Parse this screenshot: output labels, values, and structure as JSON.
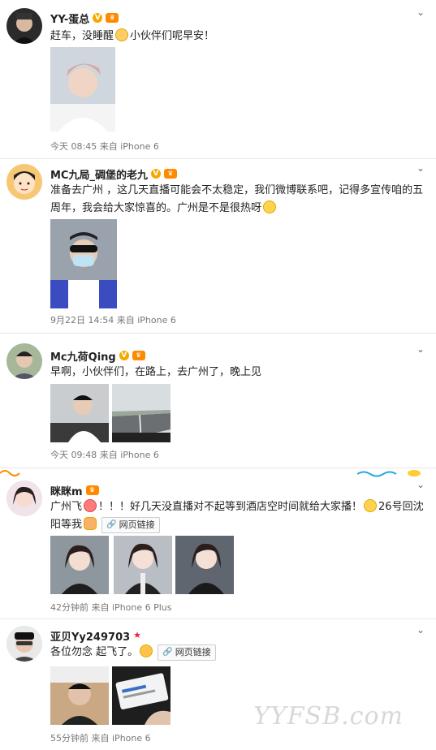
{
  "posts": [
    {
      "name": "YY-蛋总",
      "text_before": "赶车，没睡醒",
      "text_after": "小伙伴们呢早安！",
      "time": "今天 08:45",
      "source_prefix": "来自",
      "source": "iPhone 6"
    },
    {
      "name": "MC九局_碉堡的老九",
      "text": "准备去广州 ，这几天直播可能会不太稳定，我们微博联系吧，记得多宣传咱的五周年，我会给大家惊喜的。广州是不是很热呀",
      "time": "9月22日 14:54",
      "source_prefix": "来自",
      "source": "iPhone 6"
    },
    {
      "name": "Mc九荷Qing",
      "text": "早啊，小伙伴们，在路上，去广州了，晚上见",
      "time": "今天 09:48",
      "source_prefix": "来自",
      "source": "iPhone 6"
    },
    {
      "name": "眯眯m",
      "text_a": "广州飞",
      "text_b": "！！！好几天没直播对不起等到酒店空时间就给大家播！",
      "text_c": "26号回沈阳等我",
      "link_label": "网页链接",
      "time": "42分钟前",
      "source_prefix": "来自",
      "source": "iPhone 6 Plus"
    },
    {
      "name": "亚贝Yy249703",
      "text": "各位勿念 起飞了。",
      "link_label": "网页链接",
      "time": "55分钟前",
      "source_prefix": "来自",
      "source": "iPhone 6"
    }
  ],
  "watermark": "YYFSB.com",
  "icons": {
    "verified": "V-badge",
    "chevron": "chevron-down-icon",
    "link": "link-icon"
  },
  "colors": {
    "badge": "#f6a800",
    "meta": "#777777",
    "divider": "#e6e6e6"
  }
}
